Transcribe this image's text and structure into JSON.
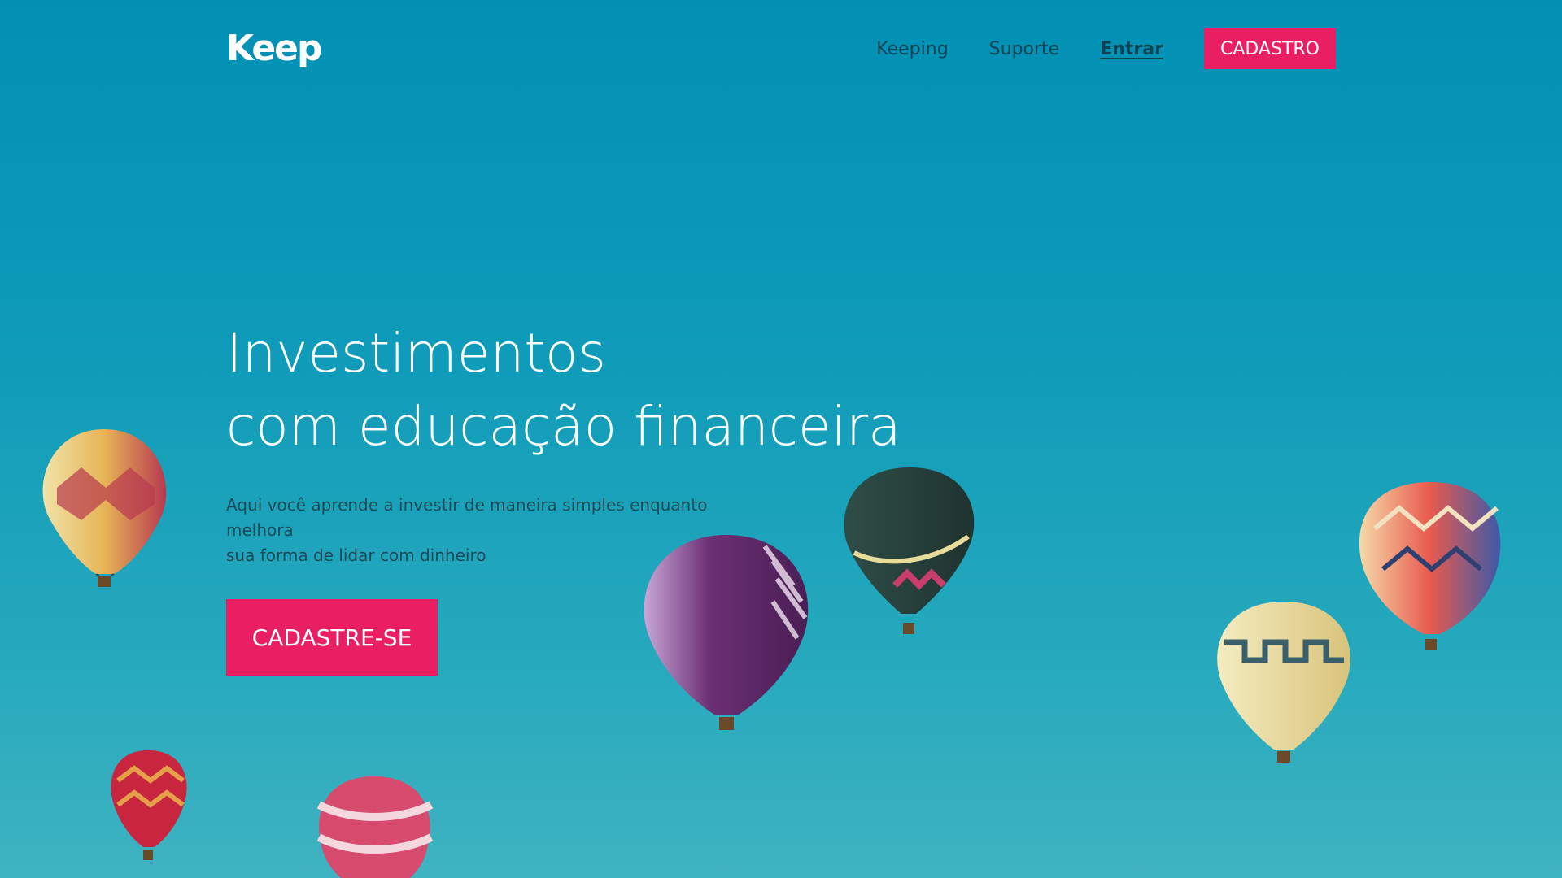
{
  "header": {
    "logo": "Keep",
    "nav": [
      {
        "label": "Keeping"
      },
      {
        "label": "Suporte"
      },
      {
        "label": "Entrar"
      }
    ],
    "cta_label": "CADASTRO"
  },
  "hero": {
    "title_line1": "Investimentos",
    "title_line2": "com educação financeira",
    "subtitle_line1": "Aqui você aprende a investir de maneira simples enquanto melhora",
    "subtitle_line2": "sua forma de lidar com dinheiro",
    "cta_label": "CADASTRE-SE"
  },
  "colors": {
    "accent": "#e91e63",
    "sky_top": "#0190b4",
    "sky_bottom": "#3fb3c1",
    "nav_text": "#123a4a"
  }
}
